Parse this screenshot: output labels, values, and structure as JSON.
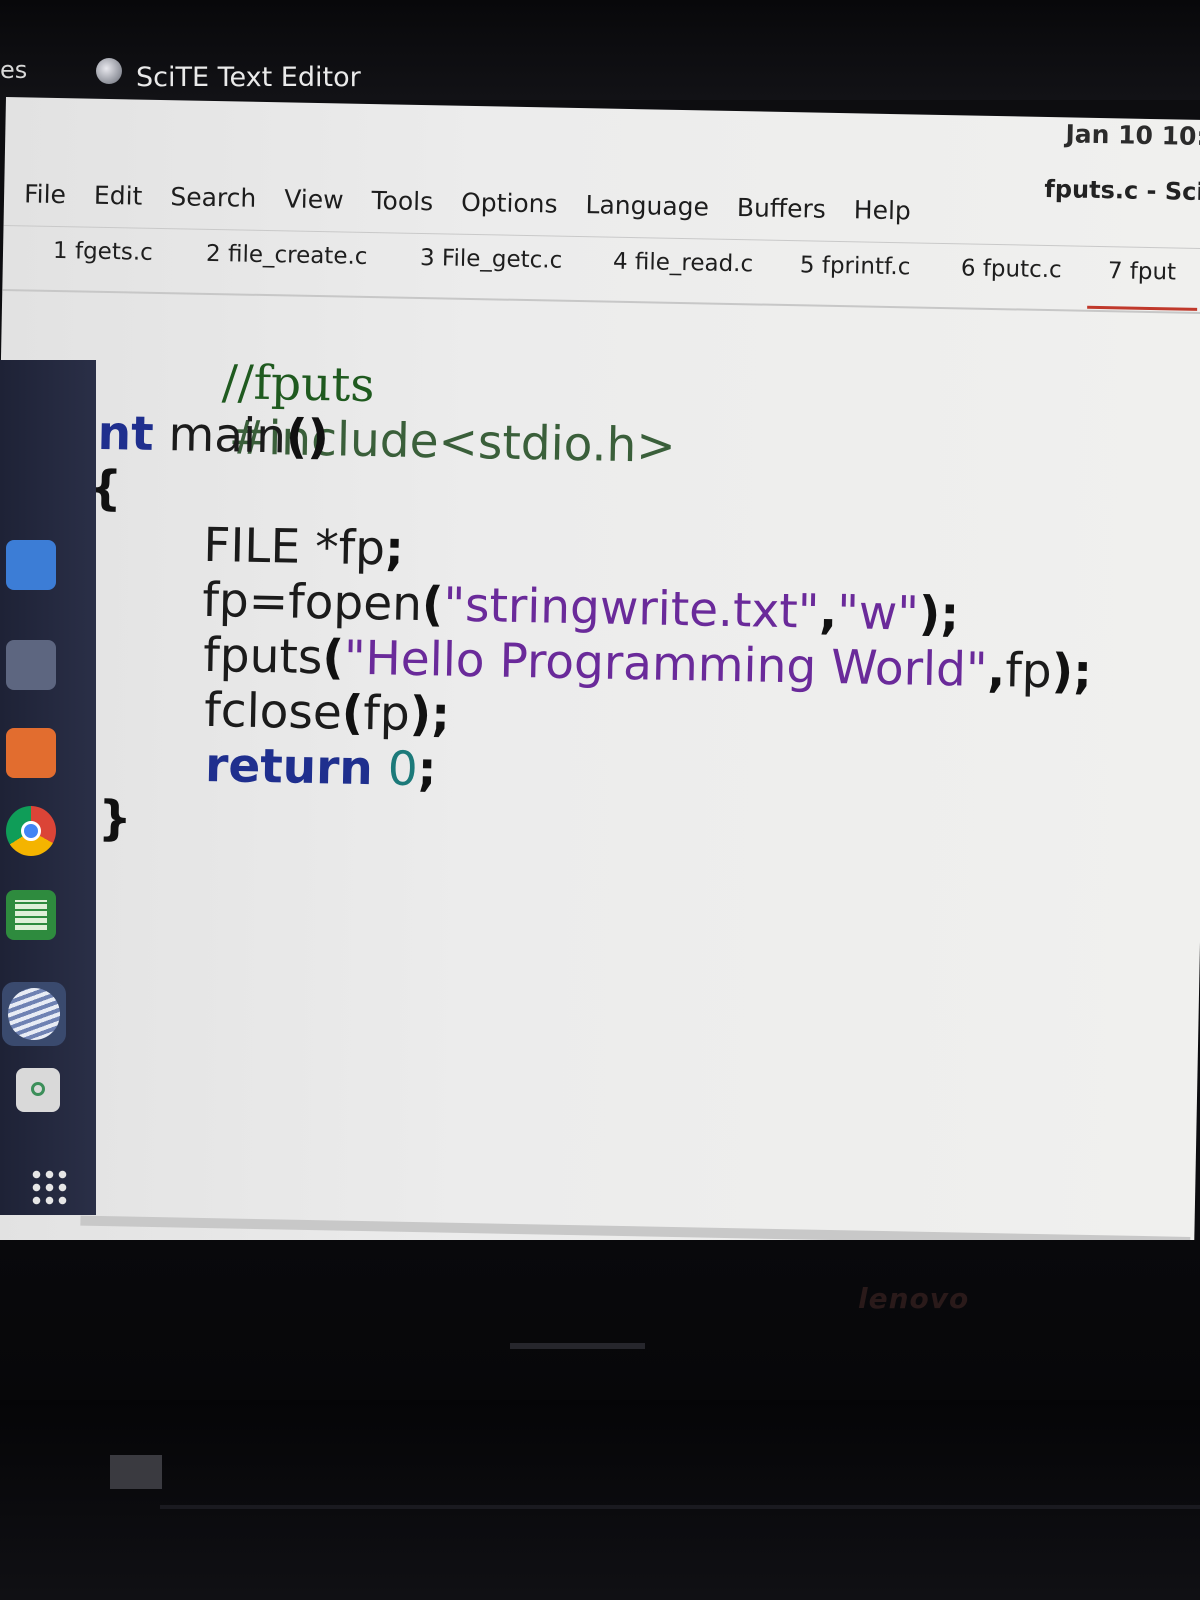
{
  "panel": {
    "activities_fragment": "es",
    "app_name": "SciTE Text Editor",
    "clock": "Jan 10 10:",
    "window_title": "fputs.c - Sci"
  },
  "menu": [
    "File",
    "Edit",
    "Search",
    "View",
    "Tools",
    "Options",
    "Language",
    "Buffers",
    "Help"
  ],
  "tabs": [
    "1 fgets.c",
    "2 file_create.c",
    "3 File_getc.c",
    "4 file_read.c",
    "5 fprintf.c",
    "6 fputc.c",
    "7 fput"
  ],
  "active_tab_index": 6,
  "code": {
    "line1": "//fputs",
    "line2": "#include<stdio.h>",
    "line3_kw": "int",
    "line3_rest": " main",
    "line3_paren": "()",
    "line4": "{",
    "line5_id": "FILE *fp",
    "line5_semi": ";",
    "line6_id": "fp=fopen",
    "line6_open": "(",
    "line6_str1": "\"stringwrite.txt\"",
    "line6_comma": ",",
    "line6_str2": "\"w\"",
    "line6_close": ");",
    "line7_id": "fputs",
    "line7_open": "(",
    "line7_str": "\"Hello Programming World\"",
    "line7_comma": ",",
    "line7_fp": "fp",
    "line7_close": ");",
    "line8_id": "fclose",
    "line8_open": "(",
    "line8_fp": "fp",
    "line8_close": ");",
    "line9_kw": "return",
    "line9_num": "0",
    "line9_semi": ";",
    "line10": "}",
    "fold_marker": "-"
  },
  "brand": "lenovo",
  "colors": {
    "keyword": "#1f2f8e",
    "string": "#6a2a9a",
    "comment": "#1f5a1f",
    "number": "#1c7a7a",
    "active_tab_underline": "#c0392b"
  },
  "dock_icons": [
    "files-icon",
    "folder-icon",
    "app-center-icon",
    "chrome-icon",
    "spreadsheet-icon",
    "scite-icon",
    "trash-icon",
    "apps-grid-icon"
  ]
}
